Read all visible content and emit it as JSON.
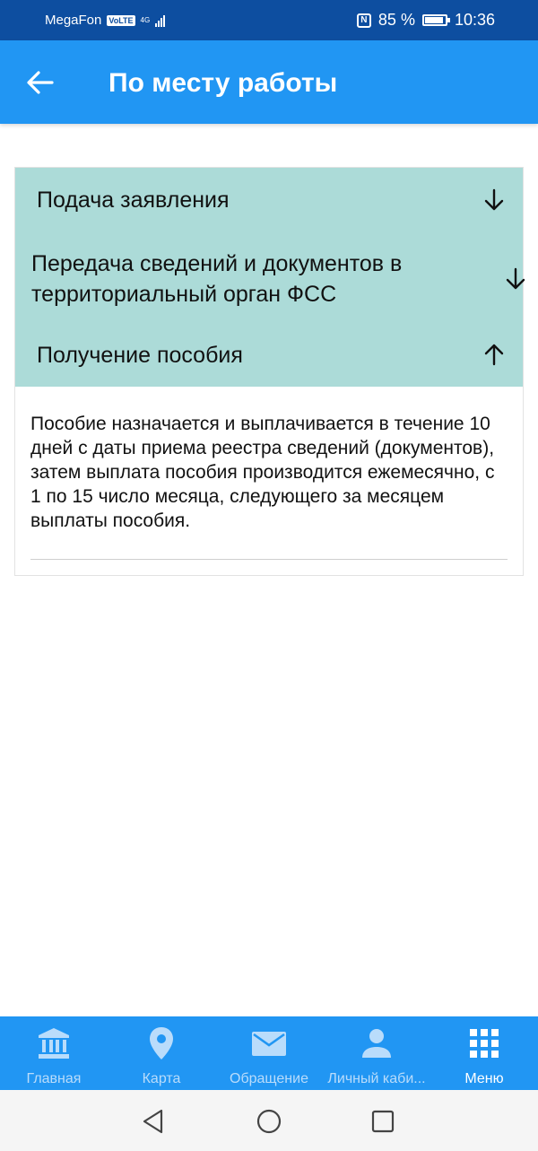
{
  "status_bar": {
    "carrier": "MegaFon",
    "volte": "VoLTE",
    "network": "4G",
    "battery": "85 %",
    "time": "10:36"
  },
  "appbar": {
    "title": "По месту работы"
  },
  "accordion": {
    "items": [
      {
        "label": "Подача заявления",
        "icon": "arrow-down-icon",
        "expanded": false
      },
      {
        "label": "Передача сведений и документов в территориальный орган ФСС",
        "icon": "arrow-down-icon",
        "expanded": false
      },
      {
        "label": "Получение пособия",
        "icon": "arrow-up-icon",
        "expanded": true
      }
    ],
    "expanded_content": "Пособие назначается и выплачивается в течение 10 дней с даты приема реестра сведений (документов), затем выплата пособия производится ежемесячно, с 1 по 15 число месяца, следующего за месяцем выплаты пособия."
  },
  "bottom_nav": {
    "items": [
      {
        "label": "Главная",
        "icon": "bank-icon"
      },
      {
        "label": "Карта",
        "icon": "map-pin-icon"
      },
      {
        "label": "Обращение",
        "icon": "mail-icon"
      },
      {
        "label": "Личный каби...",
        "icon": "person-icon"
      },
      {
        "label": "Меню",
        "icon": "grid-icon"
      }
    ],
    "active_index": 4
  },
  "colors": {
    "status_bar": "#0d4ea0",
    "primary": "#2196f3",
    "accordion_header": "#acdbd8",
    "nav_inactive_text": "#b9dcfb",
    "nav_active_text": "#ffffff"
  }
}
